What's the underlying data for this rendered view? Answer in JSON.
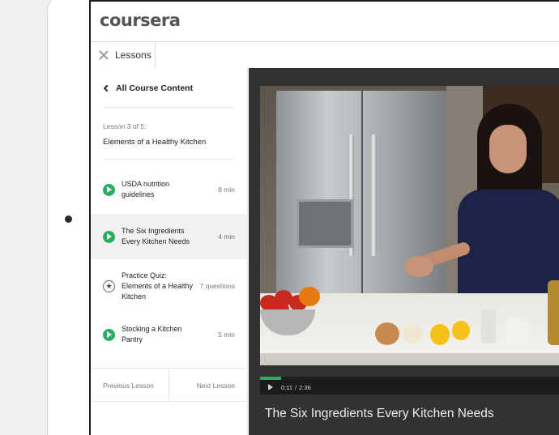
{
  "app": {
    "logo_text": "coursera"
  },
  "tabs": [
    {
      "label": "Lessons"
    }
  ],
  "sidebar": {
    "back_label": "All Course Content",
    "lesson_meta": "Lesson 3 of 5:",
    "lesson_title": "Elements of a Healthy Kitchen",
    "items": [
      {
        "label": "USDA nutrition guidelines",
        "meta": "8 min",
        "icon": "play-icon",
        "active": false
      },
      {
        "label": "The Six Ingredients Every Kitchen Needs",
        "meta": "4 min",
        "icon": "play-icon",
        "active": true
      },
      {
        "label": "Practice Quiz: Elements of a Healthy Kitchen",
        "meta": "7 questions",
        "icon": "star-icon",
        "active": false
      },
      {
        "label": "Stocking a Kitchen Pantry",
        "meta": "5 min",
        "icon": "play-icon",
        "active": false
      }
    ],
    "prev_label": "Previous Lesson",
    "next_label": "Next Lesson"
  },
  "player": {
    "current_time": "0:11",
    "time_separator": "/",
    "duration": "2:36",
    "progress_fraction": 0.07,
    "video_title": "The Six Ingredients Every Kitchen Needs"
  },
  "colors": {
    "accent": "#27ae60",
    "player_bg": "#323232"
  }
}
